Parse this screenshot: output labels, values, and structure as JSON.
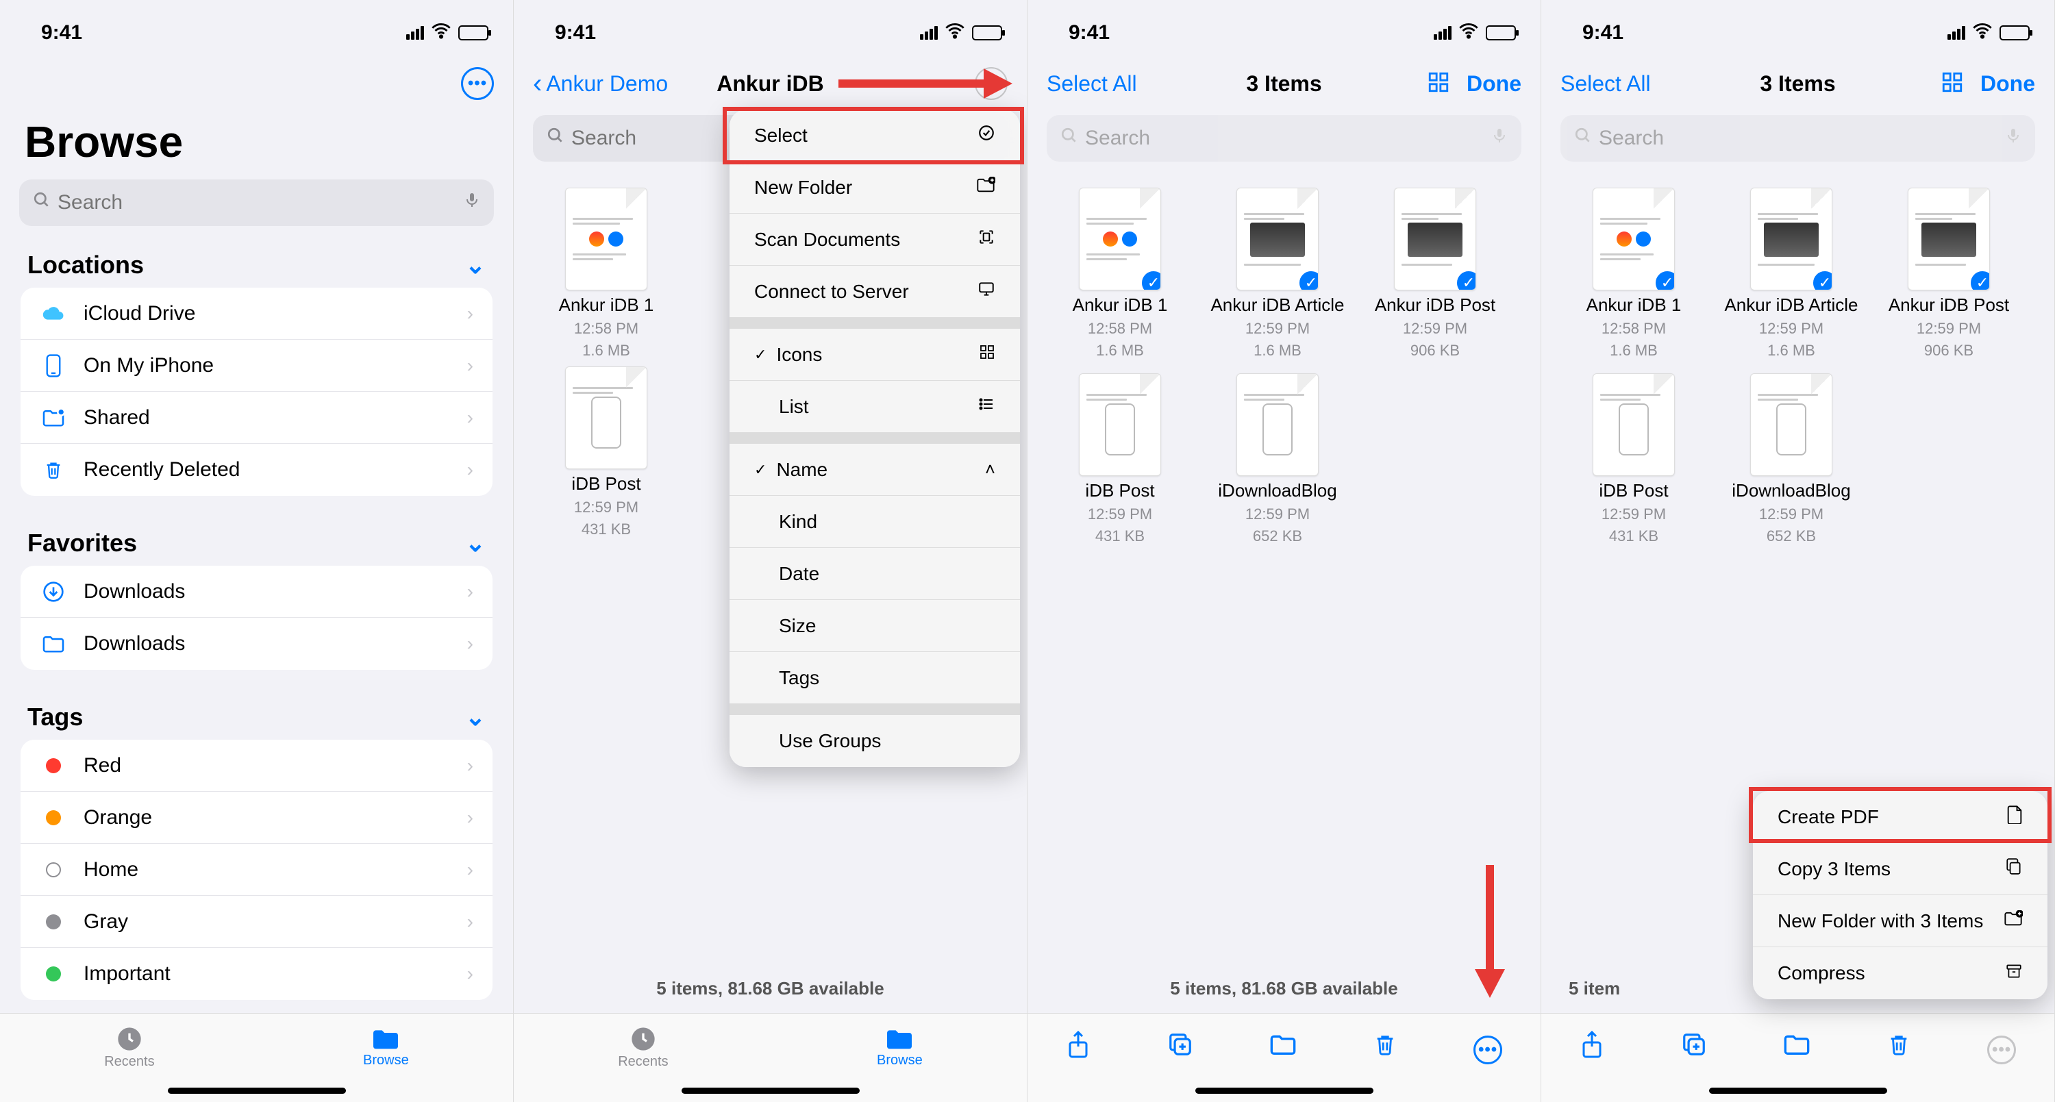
{
  "status": {
    "time": "9:41"
  },
  "pane1": {
    "title": "Browse",
    "search_placeholder": "Search",
    "sections": {
      "locations": {
        "header": "Locations",
        "items": [
          {
            "id": "icloud",
            "label": "iCloud Drive"
          },
          {
            "id": "onmyiphone",
            "label": "On My iPhone"
          },
          {
            "id": "shared",
            "label": "Shared"
          },
          {
            "id": "recentlydeleted",
            "label": "Recently Deleted"
          }
        ]
      },
      "favorites": {
        "header": "Favorites",
        "items": [
          {
            "id": "downloads1",
            "label": "Downloads"
          },
          {
            "id": "downloads2",
            "label": "Downloads"
          }
        ]
      },
      "tags": {
        "header": "Tags",
        "items": [
          {
            "id": "red",
            "label": "Red"
          },
          {
            "id": "orange",
            "label": "Orange"
          },
          {
            "id": "home",
            "label": "Home"
          },
          {
            "id": "gray",
            "label": "Gray"
          },
          {
            "id": "important",
            "label": "Important"
          }
        ]
      }
    },
    "tabs": {
      "recents": "Recents",
      "browse": "Browse"
    }
  },
  "pane2": {
    "back_label": "Ankur Demo",
    "title": "Ankur iDB",
    "search_placeholder": "Search",
    "menu": {
      "select": "Select",
      "new_folder": "New Folder",
      "scan_documents": "Scan Documents",
      "connect_to_server": "Connect to Server",
      "icons": "Icons",
      "list": "List",
      "name": "Name",
      "kind": "Kind",
      "date": "Date",
      "size": "Size",
      "tags": "Tags",
      "use_groups": "Use Groups"
    },
    "files": [
      {
        "name": "Ankur iDB 1",
        "time": "12:58 PM",
        "size": "1.6 MB"
      },
      {
        "name": "iDB Post",
        "time": "12:59 PM",
        "size": "431 KB"
      }
    ],
    "footer": "5 items, 81.68 GB available",
    "tabs": {
      "recents": "Recents",
      "browse": "Browse"
    }
  },
  "pane3": {
    "select_all": "Select All",
    "title": "3 Items",
    "done": "Done",
    "search_placeholder": "Search",
    "files": [
      {
        "name": "Ankur iDB 1",
        "time": "12:58 PM",
        "size": "1.6 MB"
      },
      {
        "name": "Ankur iDB Article",
        "time": "12:59 PM",
        "size": "1.6 MB"
      },
      {
        "name": "Ankur iDB Post",
        "time": "12:59 PM",
        "size": "906 KB"
      },
      {
        "name": "iDB Post",
        "time": "12:59 PM",
        "size": "431 KB"
      },
      {
        "name": "iDownloadBlog",
        "time": "12:59 PM",
        "size": "652 KB"
      }
    ],
    "selected": [
      true,
      true,
      true,
      false,
      false
    ],
    "footer": "5 items, 81.68 GB available"
  },
  "pane4": {
    "select_all": "Select All",
    "title": "3 Items",
    "done": "Done",
    "search_placeholder": "Search",
    "files": [
      {
        "name": "Ankur iDB 1",
        "time": "12:58 PM",
        "size": "1.6 MB"
      },
      {
        "name": "Ankur iDB Article",
        "time": "12:59 PM",
        "size": "1.6 MB"
      },
      {
        "name": "Ankur iDB Post",
        "time": "12:59 PM",
        "size": "906 KB"
      },
      {
        "name": "iDB Post",
        "time": "12:59 PM",
        "size": "431 KB"
      },
      {
        "name": "iDownloadBlog",
        "time": "12:59 PM",
        "size": "652 KB"
      }
    ],
    "selected": [
      true,
      true,
      true,
      false,
      false
    ],
    "footer": "5 item",
    "context_menu": {
      "create_pdf": "Create PDF",
      "copy": "Copy 3 Items",
      "new_folder": "New Folder with 3 Items",
      "compress": "Compress"
    }
  }
}
